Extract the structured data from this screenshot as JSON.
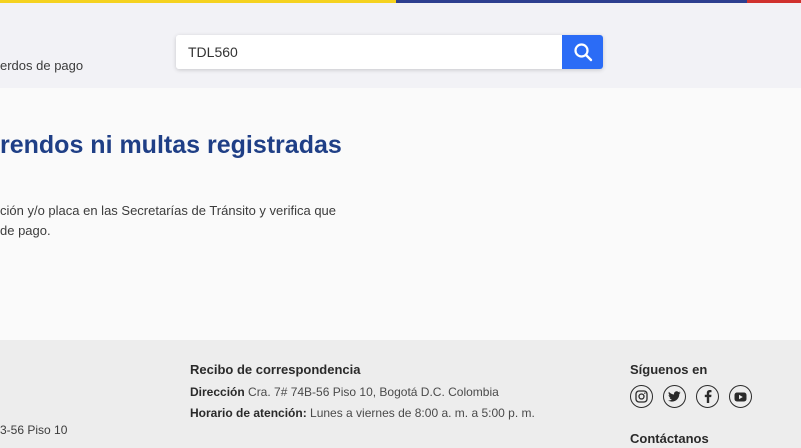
{
  "header": {
    "breadcrumb": "erdos de pago",
    "search": {
      "value": "TDL560"
    }
  },
  "main": {
    "title": "rendos ni multas registradas",
    "desc_line1": "ción y/o placa en las Secretarías de Tránsito y verifica que",
    "desc_line2": "de pago."
  },
  "footer": {
    "left_text": "3-56 Piso 10",
    "correspondence": {
      "heading": "Recibo de correspondencia",
      "address_label": "Dirección",
      "address_value": " Cra. 7# 74B-56 Piso 10, Bogotá D.C. Colombia",
      "hours_label": "Horario de atención:",
      "hours_value": " Lunes a viernes de 8:00 a. m. a 5:00 p. m."
    },
    "follow": {
      "heading": "Síguenos en",
      "icons": [
        "instagram-icon",
        "twitter-icon",
        "facebook-icon",
        "youtube-icon"
      ]
    },
    "contact_heading": "Contáctanos"
  },
  "colors": {
    "accent": "#2b6cf6",
    "title": "#1f3f86",
    "flag_yellow": "#f5d21f",
    "flag_blue": "#2d3f8f",
    "flag_red": "#d0312d"
  }
}
